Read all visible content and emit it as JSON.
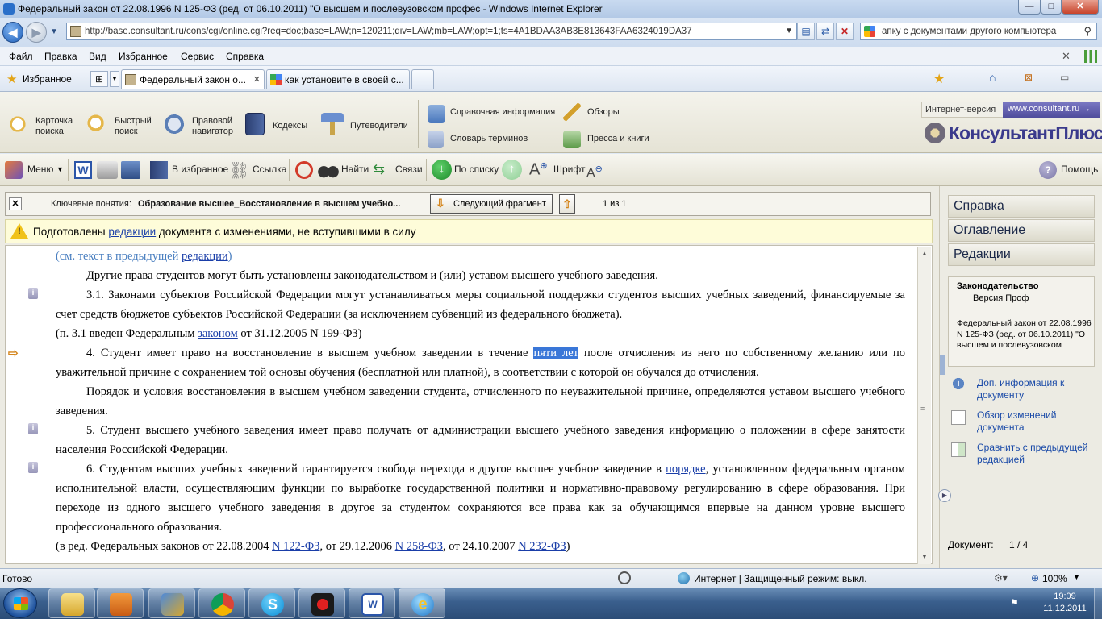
{
  "window": {
    "title": "Федеральный закон от 22.08.1996 N 125-ФЗ (ред. от 06.10.2011) \"О высшем и послевузовском профес - Windows Internet Explorer",
    "min_label": "—",
    "max_label": "□",
    "close_label": "✕"
  },
  "addressbar": {
    "url": "http://base.consultant.ru/cons/cgi/online.cgi?req=doc;base=LAW;n=120211;div=LAW;mb=LAW;opt=1;ts=4A1BDAA3AB3E813643FAA6324019DA37",
    "search_value": "апку с документами другого компьютера"
  },
  "menu": [
    "Файл",
    "Правка",
    "Вид",
    "Избранное",
    "Сервис",
    "Справка"
  ],
  "tabs": {
    "favorites_label": "Избранное",
    "tab1": "Федеральный закон о...",
    "tab2": "как установите в своей с..."
  },
  "toolbar1": {
    "card_search": [
      "Карточка",
      "поиска"
    ],
    "quick_search": [
      "Быстрый",
      "поиск"
    ],
    "legal_nav": [
      "Правовой",
      "навигатор"
    ],
    "codes": "Кодексы",
    "guides": "Путеводители",
    "reference": "Справочная информация",
    "reviews": "Обзоры",
    "dictionary": "Словарь терминов",
    "press": "Пресса и книги",
    "internet_version": "Интернет-версия",
    "site": "www.consultant.ru →",
    "brand": "КонсультантПлюс"
  },
  "toolbar2": {
    "menu": "Меню",
    "to_favorites": "В избранное",
    "link": "Ссылка",
    "find": "Найти",
    "links": "Связи",
    "by_list": "По списку",
    "font": "Шрифт",
    "help": "Помощь"
  },
  "keybar": {
    "label": "Ключевые понятия:",
    "value": "Образование высшее_Восстановление в высшем учебно...",
    "next_button": "Следующий фрагмент",
    "counter": "1 из 1"
  },
  "warning": {
    "before": "Подготовлены ",
    "link": "редакции",
    "after": " документа с изменениями, не вступившими в силу"
  },
  "document": {
    "p0_pre": "(см. текст в предыдущей ",
    "p0_link": "редакции",
    "p0_post": ")",
    "p1": "Другие права студентов могут быть установлены законодательством и (или) уставом высшего учебного заведения.",
    "p2": "3.1. Законами субъектов Российской Федерации могут устанавливаться меры социальной поддержки студентов высших учебных заведений, финансируемые за счет средств бюджетов субъектов Российской Федерации (за исключением субвенций из федерального бюджета).",
    "p3_pre": "(п. 3.1 введен Федеральным ",
    "p3_link": "законом",
    "p3_post": " от 31.12.2005 N 199-ФЗ)",
    "p4_pre": "4. Студент имеет право на восстановление в высшем учебном заведении в течение ",
    "p4_hl": "пяти лет",
    "p4_post": " после отчисления из него по собственному желанию или по уважительной причине с сохранением той основы обучения (бесплатной или платной), в соответствии с которой он обучался до отчисления.",
    "p5": "Порядок и условия восстановления в высшем учебном заведении студента, отчисленного по неуважительной причине, определяются уставом высшего учебного заведения.",
    "p6": "5. Студент высшего учебного заведения имеет право получать от администрации высшего учебного заведения информацию о положении в сфере занятости населения Российской Федерации.",
    "p7_pre": "6. Студентам высших учебных заведений гарантируется свобода перехода в другое высшее учебное заведение в ",
    "p7_link": "порядке",
    "p7_post": ", установленном федеральным органом исполнительной власти, осуществляющим функции по выработке государственной политики и нормативно-правовому регулированию в сфере образования. При переходе из одного высшего учебного заведения в другое за студентом сохраняются все права как за обучающимся впервые на данном уровне высшего профессионального образования.",
    "p8_pre": "(в ред. Федеральных законов от 22.08.2004 ",
    "p8_l1": "N 122-ФЗ",
    "p8_mid1": ", от 29.12.2006 ",
    "p8_l2": "N 258-ФЗ",
    "p8_mid2": ", от 24.10.2007 ",
    "p8_l3": "N 232-ФЗ",
    "p8_post": ")"
  },
  "rightpanel": {
    "help": "Справка",
    "contents": "Оглавление",
    "editions": "Редакции",
    "box_title": "Законодательство",
    "box_sub": "Версия Проф",
    "box_doc": "Федеральный закон от 22.08.1996 N 125-ФЗ (ред. от 06.10.2011) \"О высшем и послевузовском",
    "link1": "Доп. информация к документу",
    "link2": "Обзор изменений документа",
    "link3": "Сравнить с предыдущей редакцией",
    "doc_label": "Документ:",
    "doc_counter": "1 / 4"
  },
  "statusbar": {
    "ready": "Готово",
    "zone": "Интернет | Защищенный режим: выкл.",
    "zoom": "100%"
  },
  "taskbar": {
    "time": "19:09",
    "date": "11.12.2011"
  },
  "colors": {
    "link": "#1a3ea8",
    "highlight": "#3a77d8",
    "warning_bg": "#fefcd9",
    "brand": "#3a3a8c"
  }
}
